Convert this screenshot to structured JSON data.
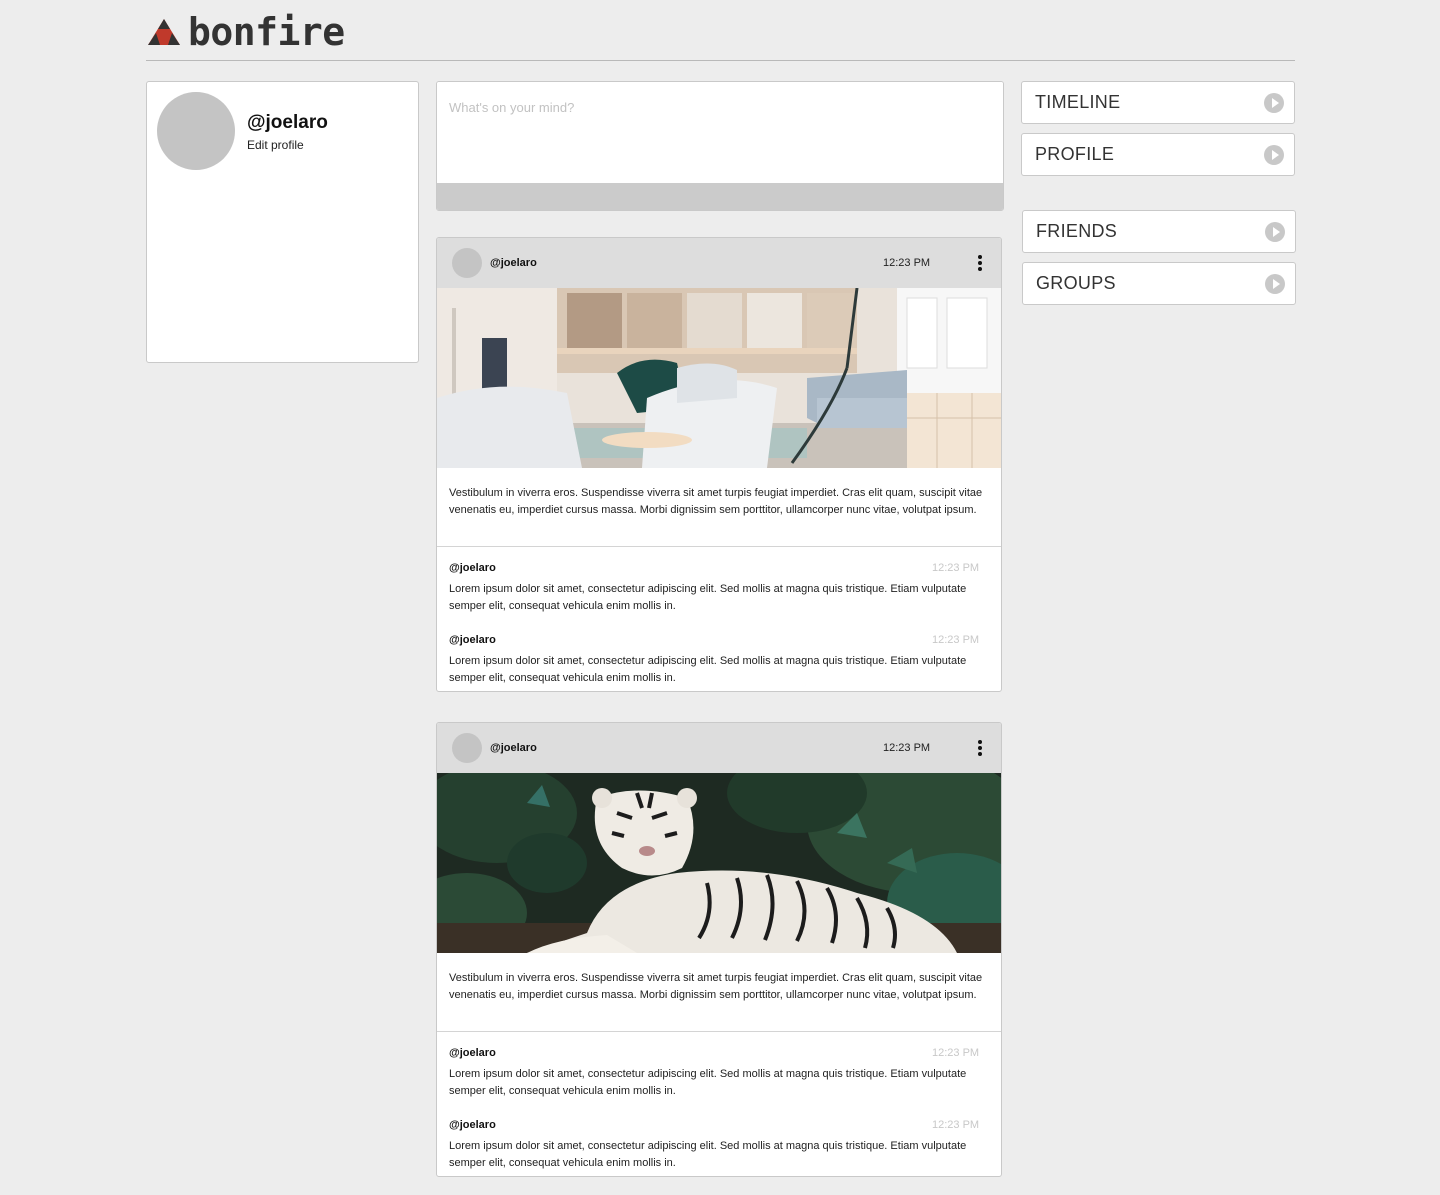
{
  "app": {
    "name": "bonfire",
    "logo_icon": "bonfire-logo-icon",
    "brand_color": "#c0392b"
  },
  "profile_card": {
    "handle": "@joelaro",
    "edit_label": "Edit profile"
  },
  "composer": {
    "placeholder": "What's on your mind?"
  },
  "nav": {
    "items": [
      {
        "label": "TIMELINE",
        "icon": "play-circle-icon"
      },
      {
        "label": "PROFILE",
        "icon": "play-circle-icon"
      },
      {
        "label": "FRIENDS",
        "icon": "play-circle-icon"
      },
      {
        "label": "GROUPS",
        "icon": "play-circle-icon"
      }
    ]
  },
  "posts": [
    {
      "user": "@joelaro",
      "time": "12:23 PM",
      "image": "office-lounge-photo",
      "body": "Vestibulum in viverra eros. Suspendisse viverra sit amet turpis feugiat imperdiet. Cras elit quam, suscipit vitae venenatis eu, imperdiet cursus massa. Morbi dignissim sem porttitor, ullamcorper nunc vitae, volutpat ipsum.",
      "comments": [
        {
          "user": "@joelaro",
          "time": "12:23 PM",
          "text": "Lorem ipsum dolor sit amet, consectetur adipiscing elit. Sed mollis at magna quis tristique. Etiam vulputate semper elit, consequat vehicula enim mollis in."
        },
        {
          "user": "@joelaro",
          "time": "12:23 PM",
          "text": "Lorem ipsum dolor sit amet, consectetur adipiscing elit. Sed mollis at magna quis tristique. Etiam vulputate semper elit, consequat vehicula enim mollis in."
        }
      ]
    },
    {
      "user": "@joelaro",
      "time": "12:23 PM",
      "image": "white-tiger-photo",
      "body": "Vestibulum in viverra eros. Suspendisse viverra sit amet turpis feugiat imperdiet. Cras elit quam, suscipit vitae venenatis eu, imperdiet cursus massa. Morbi dignissim sem porttitor, ullamcorper nunc vitae, volutpat ipsum.",
      "comments": [
        {
          "user": "@joelaro",
          "time": "12:23 PM",
          "text": "Lorem ipsum dolor sit amet, consectetur adipiscing elit. Sed mollis at magna quis tristique. Etiam vulputate semper elit, consequat vehicula enim mollis in."
        },
        {
          "user": "@joelaro",
          "time": "12:23 PM",
          "text": "Lorem ipsum dolor sit amet, consectetur adipiscing elit. Sed mollis at magna quis tristique. Etiam vulputate semper elit, consequat vehicula enim mollis in."
        }
      ]
    }
  ]
}
